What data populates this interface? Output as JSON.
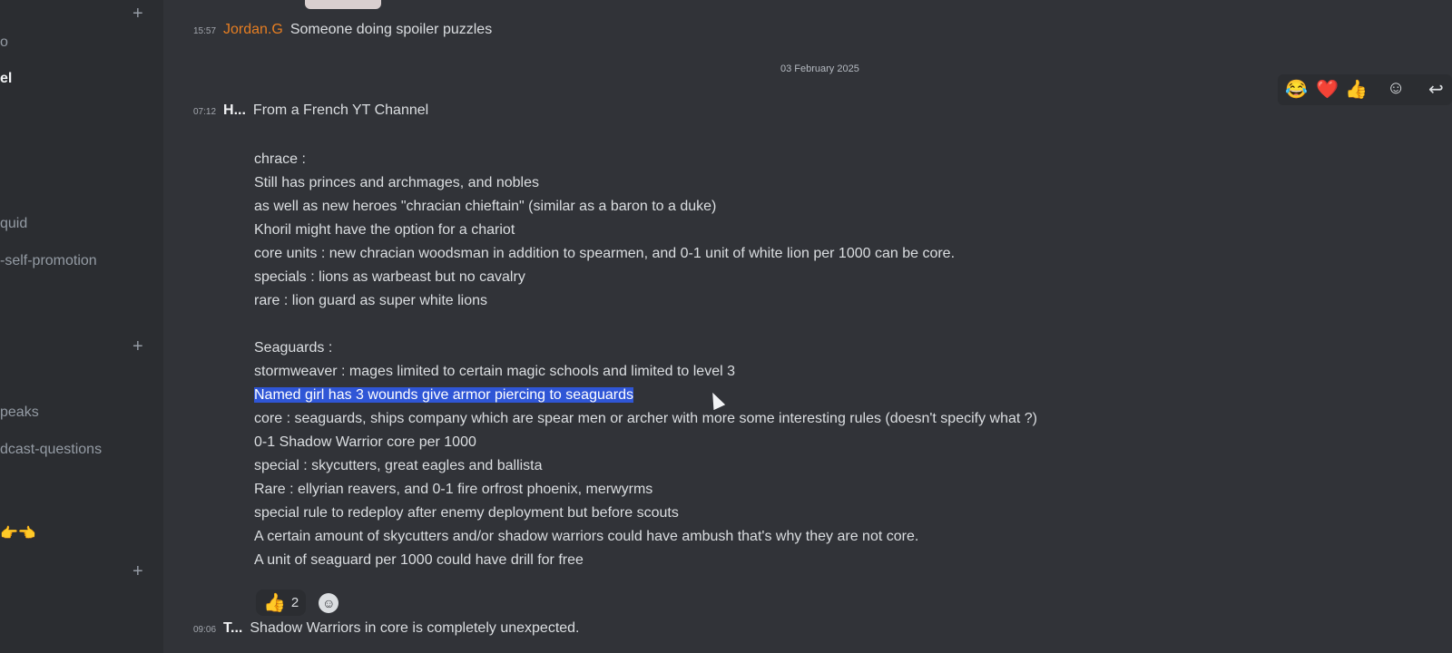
{
  "sidebar": {
    "items": [
      {
        "label": "o"
      },
      {
        "label": "el"
      },
      {
        "label": "quid"
      },
      {
        "label": "-self-promotion"
      },
      {
        "label": "peaks"
      },
      {
        "label": "dcast-questions"
      }
    ],
    "plus": "+",
    "emoji": "👉👈"
  },
  "messages": {
    "top": {
      "time": "15:57",
      "author": "Jordan.G",
      "text": "Someone doing spoiler puzzles"
    },
    "date_separator": "03 February 2025",
    "main": {
      "time": "07:12",
      "author": "H...",
      "text": "From a French YT Channel"
    },
    "bottom": {
      "time": "09:06",
      "author": "T...",
      "text": "Shadow Warriors in core is completely unexpected."
    }
  },
  "body_lines": [
    "chrace :",
    "Still has princes and archmages, and nobles",
    "as well as new heroes \"chracian chieftain\" (similar as a baron to a duke)",
    "Khoril might have the option for a chariot",
    "core units : new chracian woodsman in addition to spearmen, and 0-1 unit of white lion per 1000 can be core.",
    "specials : lions as warbeast but no cavalry",
    "rare : lion guard as super white lions",
    "",
    "Seaguards :",
    "stormweaver : mages limited to certain magic schools and limited to level 3",
    "Named girl has 3 wounds give armor piercing to seaguards",
    "core : seaguards, ships company which are spear men or archer with more some interesting rules (doesn't specify what ?)",
    "0-1 Shadow Warrior core per 1000",
    "special : skycutters, great eagles and ballista",
    "Rare : ellyrian reavers, and 0-1 fire orfrost phoenix, merwyrms",
    "special rule to redeploy after enemy deployment but before scouts",
    "A certain amount of skycutters and/or shadow warriors could have ambush that's why they are not core.",
    "A unit of seaguard per 1000 could have drill for free"
  ],
  "reactions": [
    {
      "emoji": "👍",
      "count": "2"
    }
  ],
  "hover_toolbar": {
    "emojis": [
      "😂",
      "❤️",
      "👍"
    ],
    "add_reaction_icon": "☺",
    "reply_icon": "↩"
  },
  "colors": {
    "background": "#313338",
    "sidebar": "#2b2d31",
    "highlight": "#2f56d6",
    "author_orange": "#e67e22"
  }
}
